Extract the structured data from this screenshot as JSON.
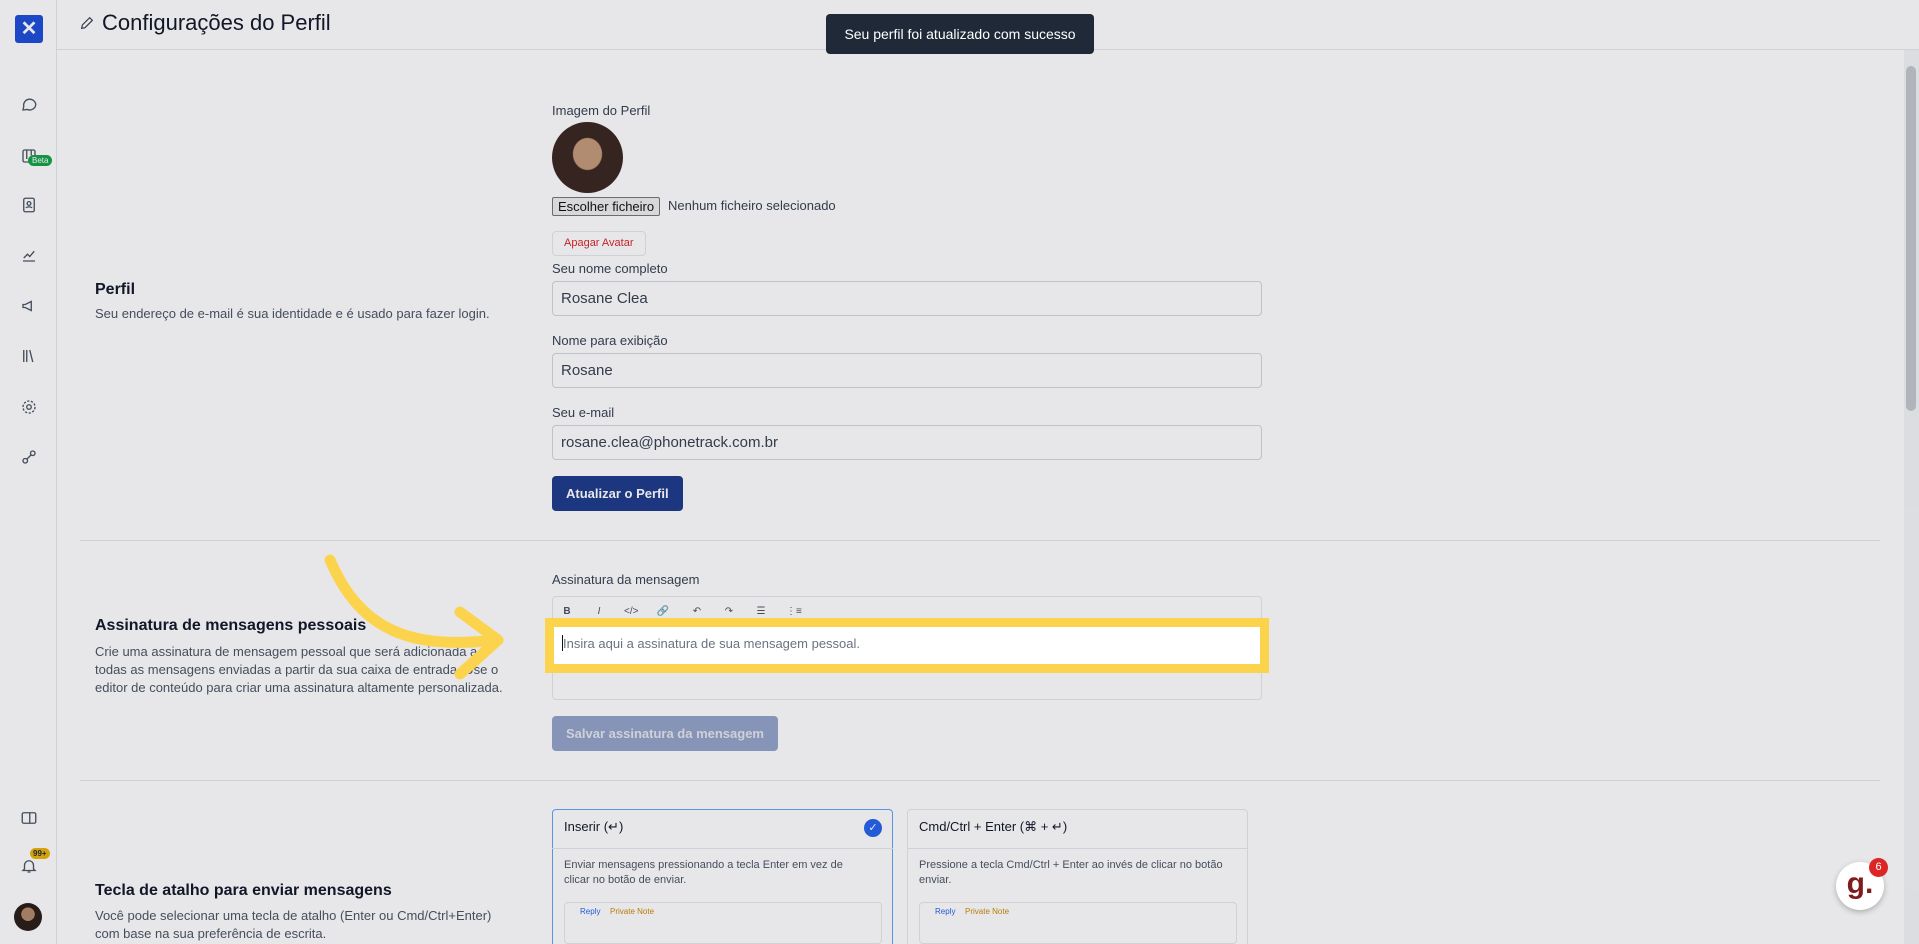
{
  "app": {
    "page_title": "Configurações do Perfil",
    "toast": "Seu perfil foi atualizado com sucesso"
  },
  "sidebar": {
    "items": [
      {
        "icon": "chat-icon"
      },
      {
        "icon": "kanban-icon",
        "badge": "Beta"
      },
      {
        "icon": "contacts-icon"
      },
      {
        "icon": "reports-icon"
      },
      {
        "icon": "campaigns-icon"
      },
      {
        "icon": "library-icon"
      },
      {
        "icon": "settings-icon"
      },
      {
        "icon": "integrations-icon"
      }
    ],
    "bottom": {
      "notification_badge": "99+"
    }
  },
  "profile": {
    "title": "Perfil",
    "description": "Seu endereço de e-mail é sua identidade e é usado para fazer login.",
    "image_label": "Imagem do Perfil",
    "file_button": "Escolher ficheiro",
    "file_status": "Nenhum ficheiro selecionado",
    "delete_avatar": "Apagar Avatar",
    "full_name_label": "Seu nome completo",
    "full_name_value": "Rosane Clea",
    "display_name_label": "Nome para exibição",
    "display_name_value": "Rosane",
    "email_label": "Seu e-mail",
    "email_value": "rosane.clea@phonetrack.com.br",
    "update_button": "Atualizar o Perfil"
  },
  "signature": {
    "title": "Assinatura de mensagens pessoais",
    "description_lines": [
      "Crie uma assinatura de mensagem pessoal que será adicionada a",
      "todas as mensagens enviadas a partir da sua caixa de entrada. Use o",
      "editor de conteúdo para criar uma assinatura altamente personalizada."
    ],
    "field_label": "Assinatura da mensagem",
    "toolbar": [
      "B",
      "I",
      "</>",
      "🔗",
      "↶",
      "↷",
      "☰",
      "⋮≡"
    ],
    "placeholder": "Insira aqui a assinatura de sua mensagem pessoal.",
    "save_button": "Salvar assinatura da mensagem"
  },
  "shortcut": {
    "title": "Tecla de atalho para enviar mensagens",
    "description_lines": [
      "Você pode selecionar uma tecla de atalho (Enter ou Cmd/Ctrl+Enter)",
      "com base na sua preferência de escrita."
    ],
    "options": [
      {
        "title": "Inserir (↵)",
        "description_lines": [
          "Enviar mensagens pressionando a tecla Enter em vez de",
          "clicar no botão de enviar."
        ],
        "selected": true,
        "preview_tabs": [
          "Reply",
          "Private Note"
        ]
      },
      {
        "title": "Cmd/Ctrl + Enter (⌘ + ↵)",
        "description_lines": [
          "Pressione a tecla Cmd/Ctrl + Enter ao invés de clicar no botão",
          "enviar."
        ],
        "selected": false,
        "preview_tabs": [
          "Reply",
          "Private Note"
        ]
      }
    ]
  },
  "help_widget": {
    "label": "g.",
    "badge": "6"
  },
  "colors": {
    "primary": "#1e3a8a",
    "highlight": "#fcd34d",
    "danger": "#dc2626",
    "beta": "#16a34a"
  }
}
